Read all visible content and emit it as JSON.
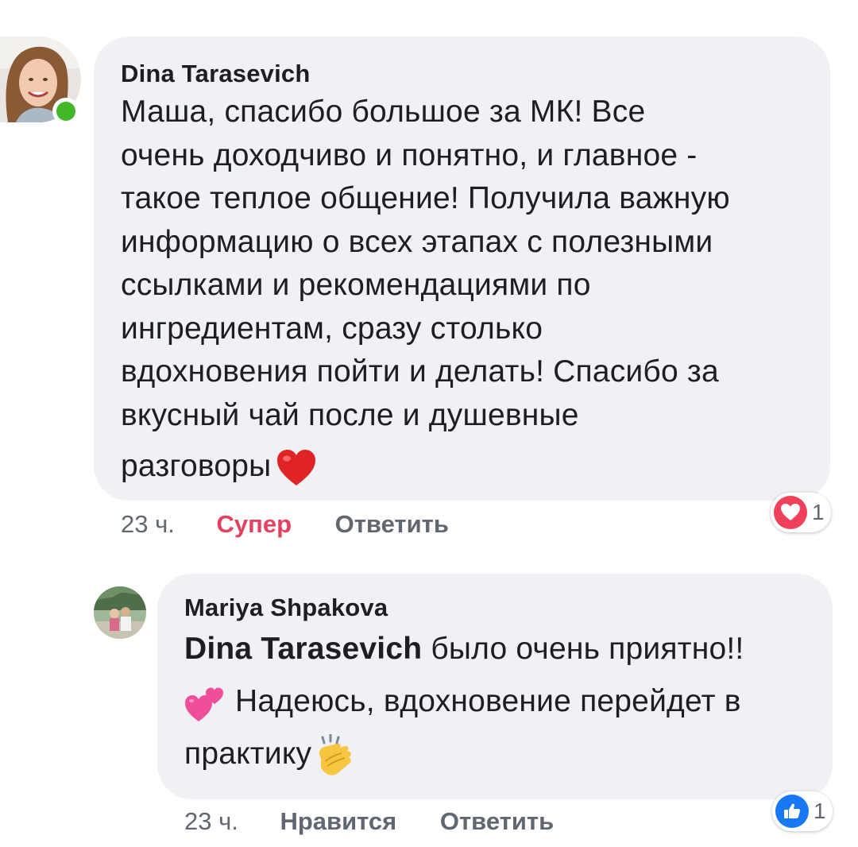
{
  "comment": {
    "author": "Dina Tarasevich",
    "text_lines": [
      "Маша, спасибо большое за МК! Все",
      "очень доходчиво и понятно, и главное -",
      "такое теплое общение! Получила важную",
      "информацию о всех этапах с полезными",
      "ссылками и рекомендациями по",
      "ингредиентам, сразу столько",
      "вдохновения пойти и делать! Спасибо за",
      "вкусный чай после и душевные",
      "разговоры"
    ],
    "trailing_emoji": "red-heart-emoji",
    "time": "23 ч.",
    "reaction_label": "Супер",
    "reply_label": "Ответить",
    "reaction_icon": "love-reaction-icon",
    "reaction_count": "1",
    "online": true
  },
  "reply": {
    "author": "Mariya Shpakova",
    "mention": "Dina Tarasevich",
    "line1_rest": "было очень приятно!!",
    "line2": "Надеюсь, вдохновение перейдет в",
    "line3": "практику",
    "emojis": [
      "two-hearts-emoji",
      "clapping-hands-emoji"
    ],
    "time": "23 ч.",
    "like_label": "Нравится",
    "reply_label": "Ответить",
    "reaction_icon": "like-reaction-icon",
    "reaction_count": "1"
  },
  "colors": {
    "bubble": "#f0f1f4",
    "love": "#e5405e",
    "like_blue": "#1877f2",
    "online_green": "#42b72a",
    "meta_gray": "#606770"
  }
}
